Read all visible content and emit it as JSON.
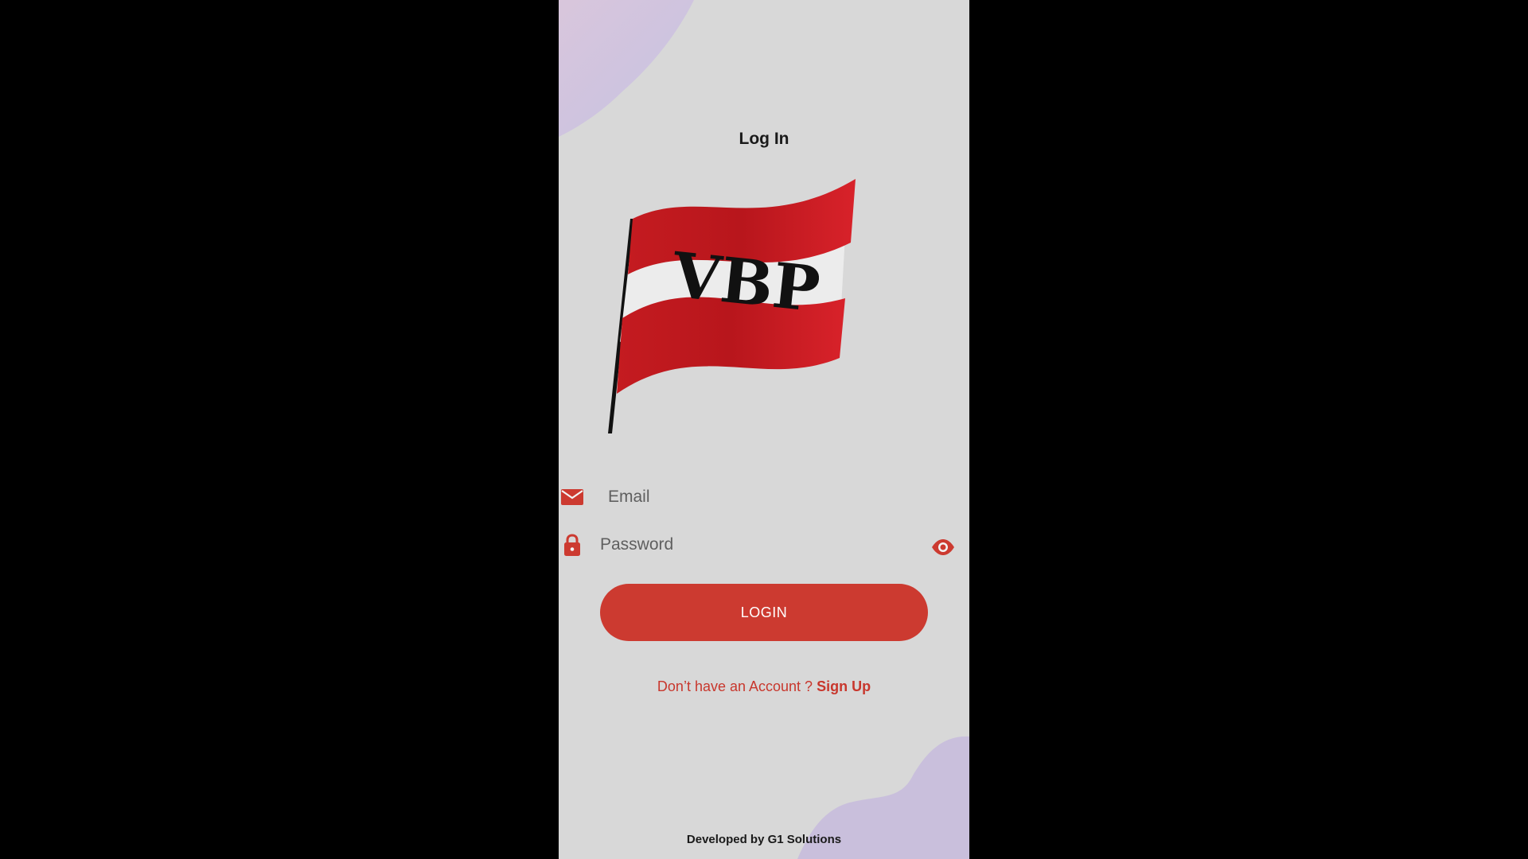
{
  "screen": {
    "title": "Log In",
    "logo_text": "VBP"
  },
  "form": {
    "email_placeholder": "Email",
    "password_placeholder": "Password",
    "login_label": "LOGIN"
  },
  "signup": {
    "prompt": "Don’t have an Account ?",
    "link_label": "Sign Up"
  },
  "footer": {
    "text": "Developed by G1 Solutions"
  },
  "icons": {
    "email": "envelope-icon",
    "password": "lock-icon",
    "visibility": "eye-icon"
  },
  "colors": {
    "accent": "#cc3a30",
    "flag_red": "#d01f24",
    "background": "#d8d8d8",
    "blob": "#c9bfdc"
  }
}
